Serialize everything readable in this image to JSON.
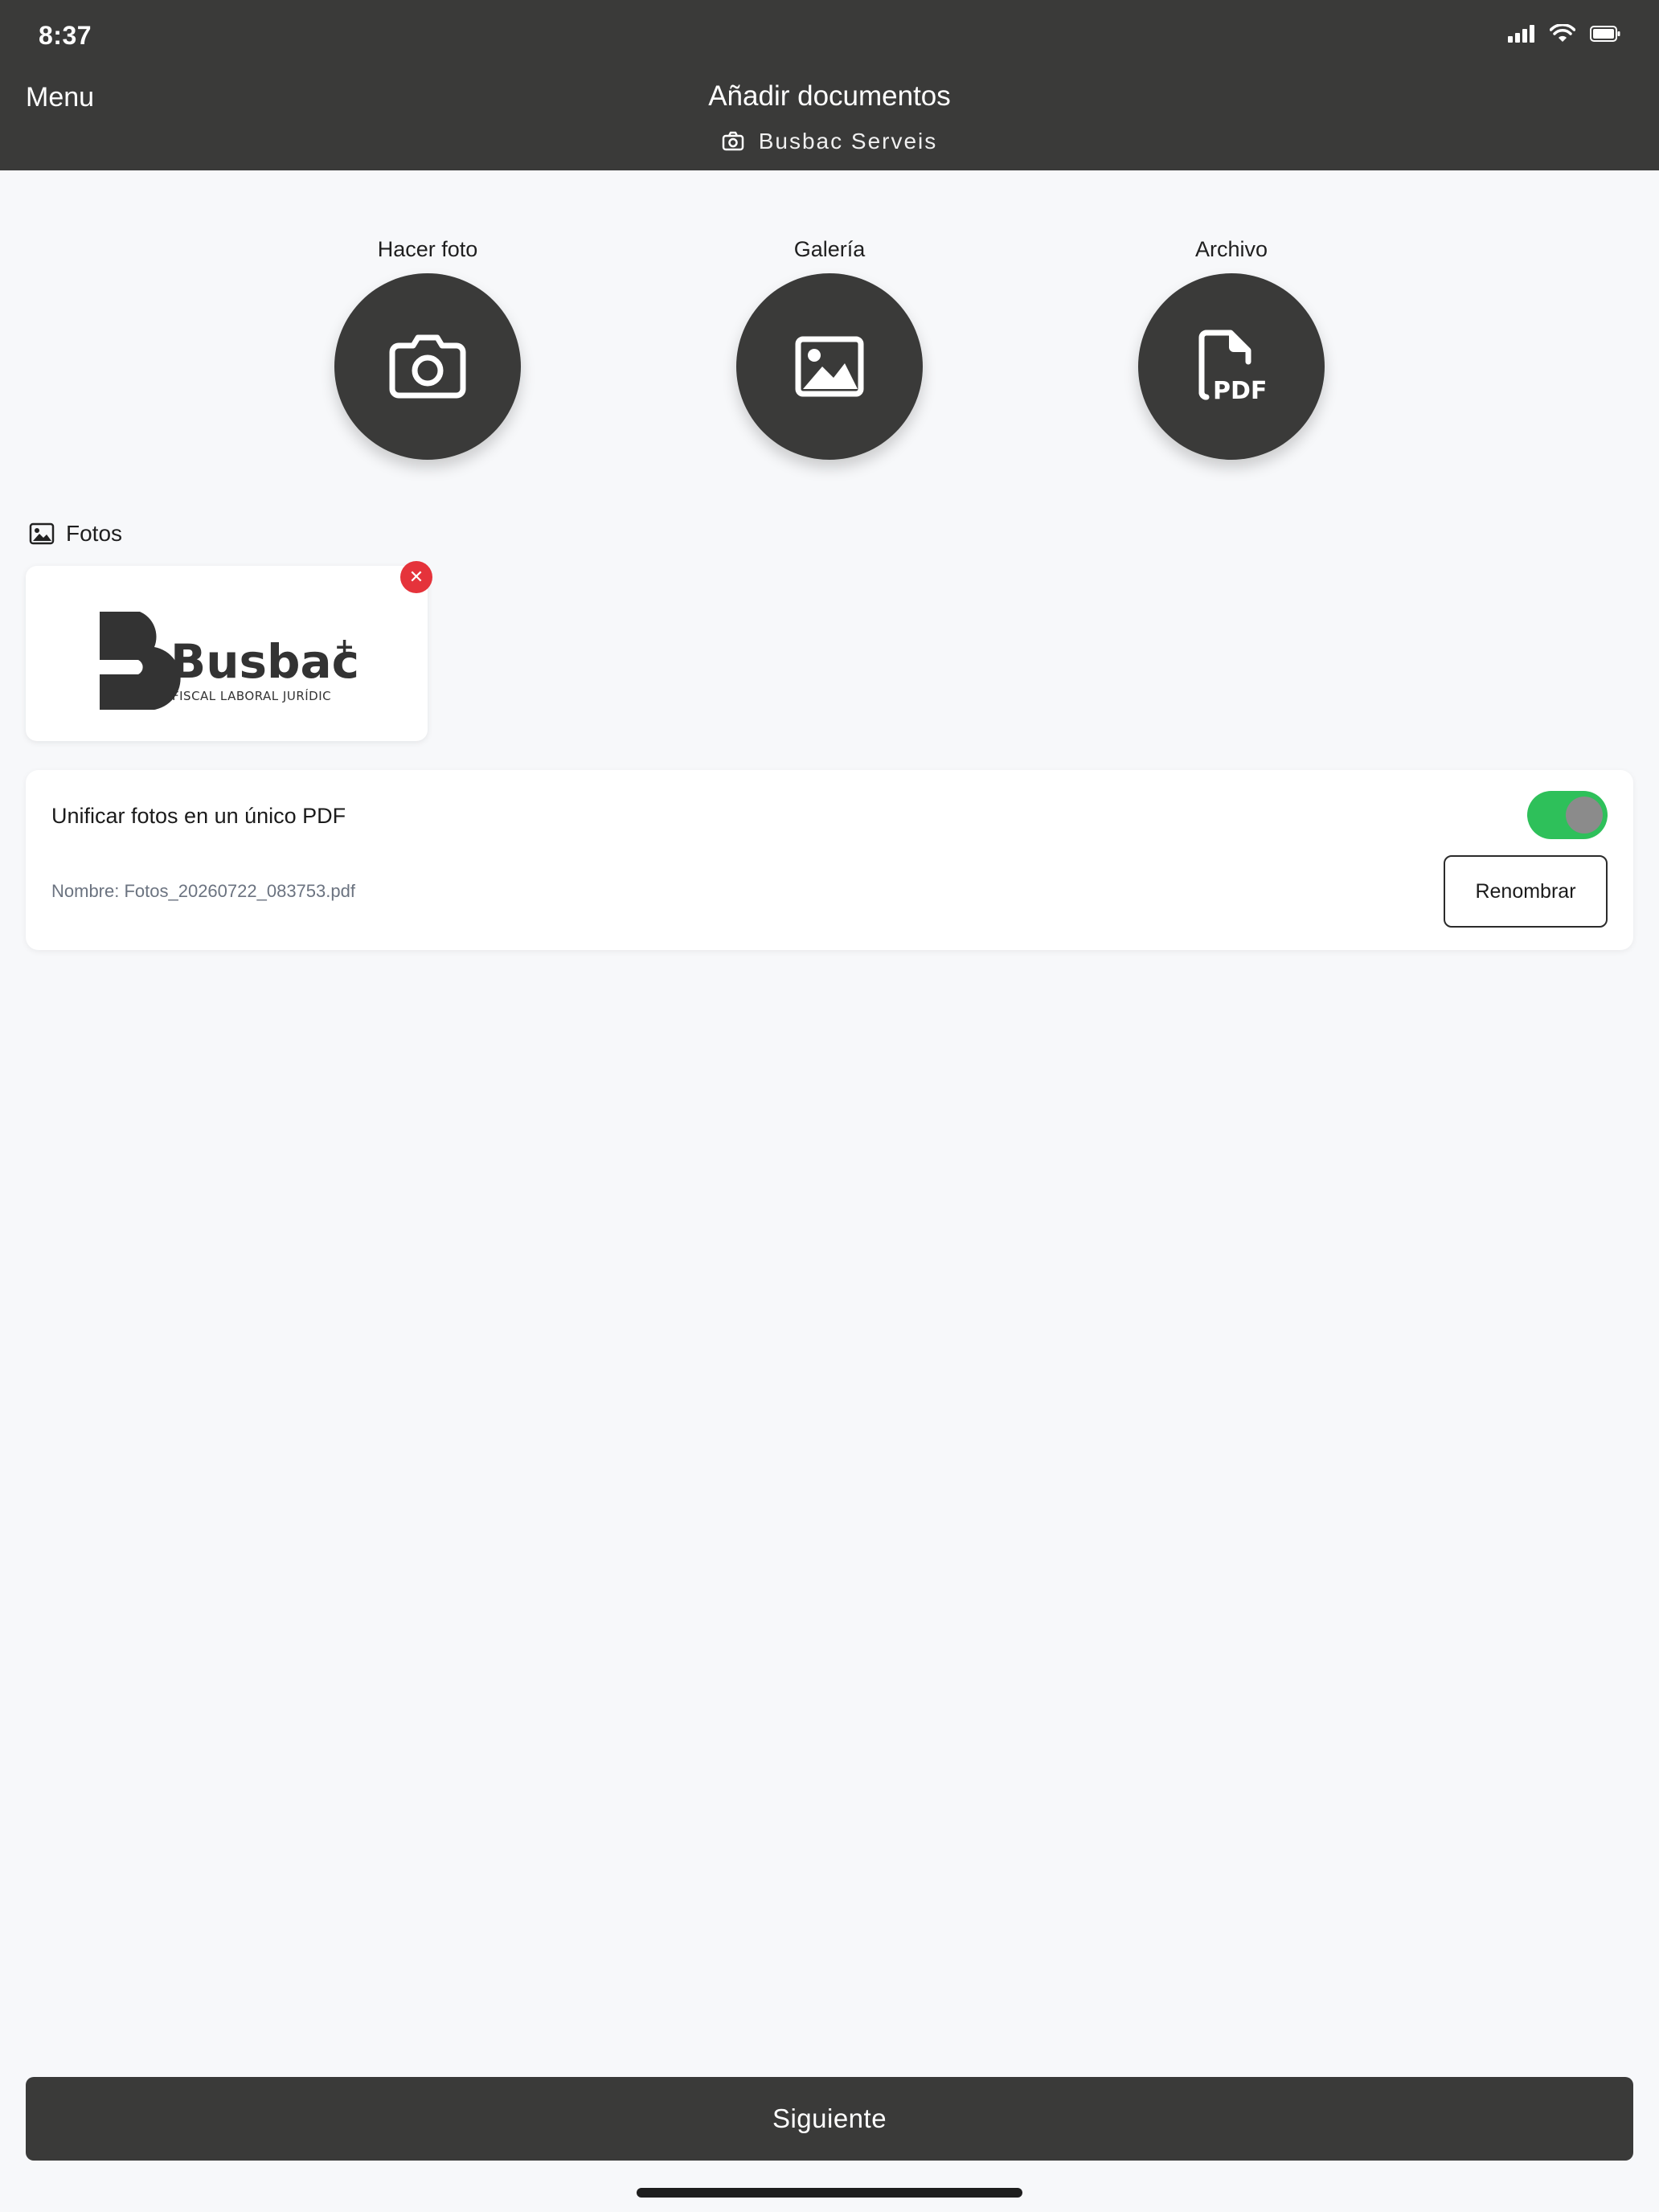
{
  "status_bar": {
    "time": "8:37"
  },
  "header": {
    "menu_label": "Menu",
    "title": "Añadir documentos",
    "subtitle": "Busbac Serveis"
  },
  "actions": [
    {
      "label": "Hacer foto",
      "icon": "camera-icon"
    },
    {
      "label": "Galería",
      "icon": "image-icon"
    },
    {
      "label": "Archivo",
      "icon": "pdf-file-icon"
    }
  ],
  "photos_section": {
    "title": "Fotos"
  },
  "photos": [
    {
      "logo_text": "Busbac",
      "logo_tagline": "FISCAL LABORAL JURÍDIC"
    }
  ],
  "merge_settings": {
    "label": "Unificar fotos en un único PDF",
    "enabled": true,
    "file_name": "Nombre: Fotos_20260722_083753.pdf",
    "rename_label": "Renombrar"
  },
  "footer": {
    "next_label": "Siguiente"
  },
  "colors": {
    "header_bg": "#3a3a39",
    "page_bg": "#f7f8fa",
    "toggle_on": "#2ec05a",
    "remove_red": "#e5333b"
  }
}
